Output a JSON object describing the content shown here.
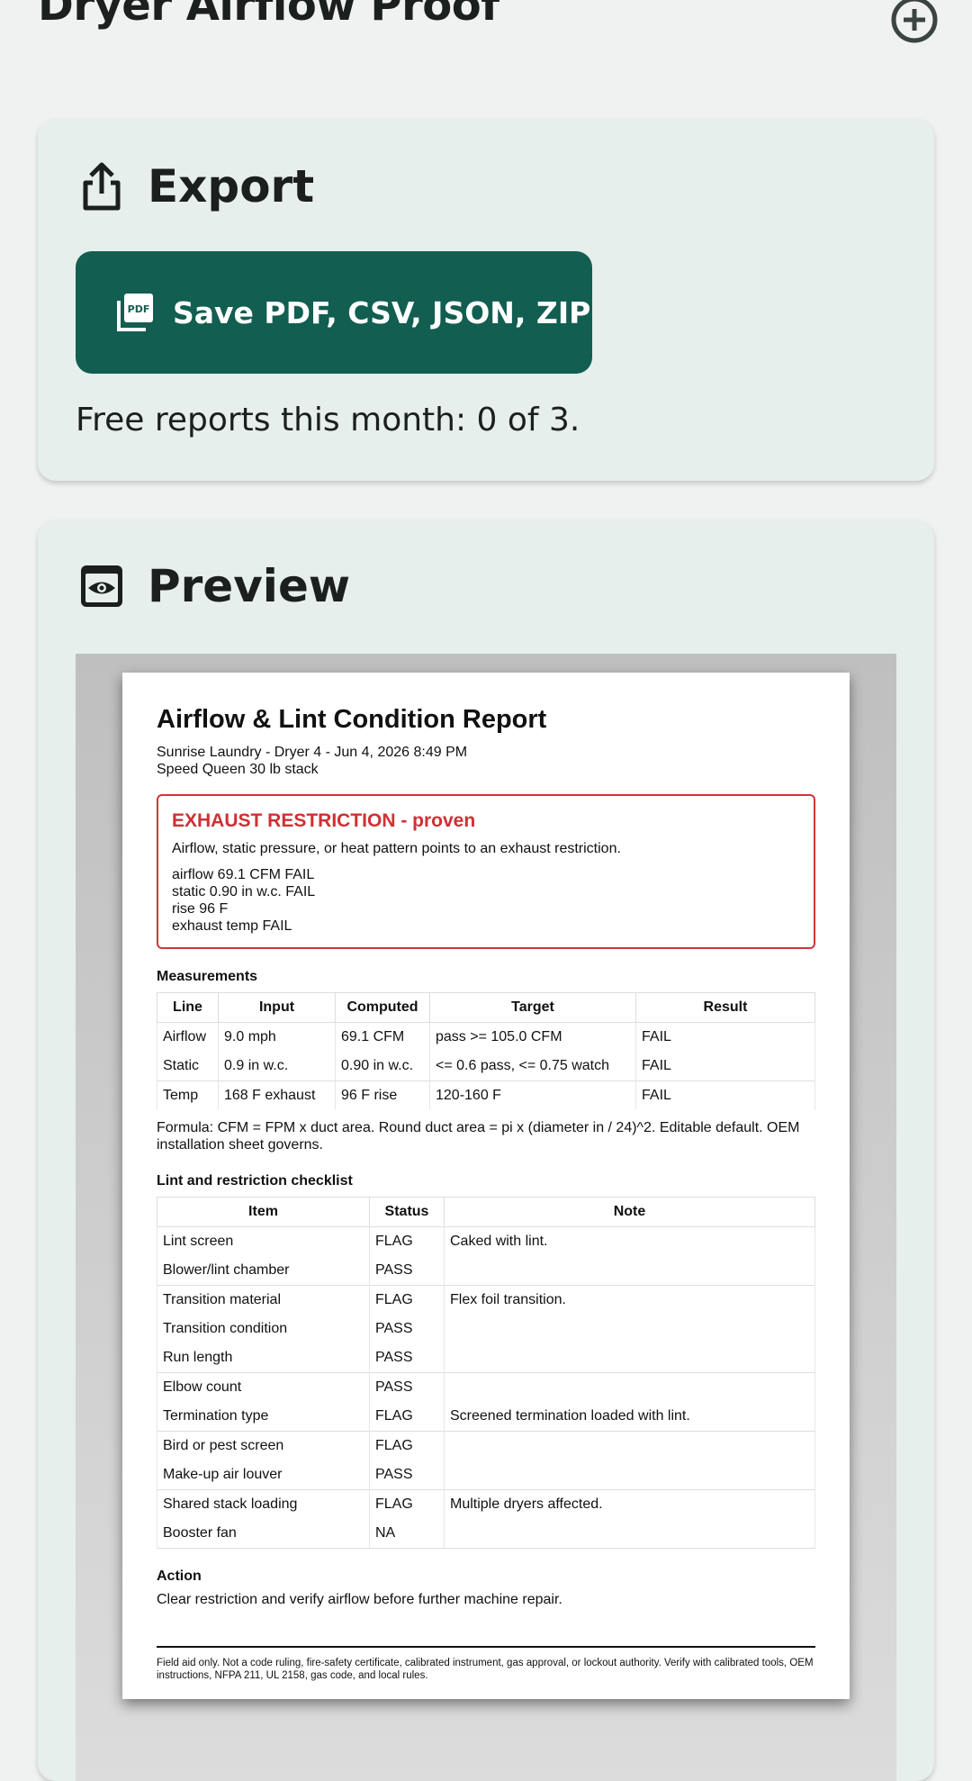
{
  "app": {
    "title": "Dryer Airflow Proof",
    "add_icon": "add-circle-icon"
  },
  "export_card": {
    "icon": "share-upload-icon",
    "title": "Export",
    "save_button_icon": "pdf-file-icon",
    "save_button_label": "Save PDF, CSV, JSON, ZIP",
    "quota_text": "Free reports this month: 0 of 3.",
    "accent_color": "#125e51"
  },
  "preview_card": {
    "icon": "preview-eye-icon",
    "title": "Preview"
  },
  "report": {
    "title": "Airflow & Lint Condition Report",
    "subtitle_line1": "Sunrise Laundry - Dryer 4 - Jun 4, 2026 8:49 PM",
    "subtitle_line2": "Speed Queen 30 lb stack",
    "alert": {
      "color": "#cf3034",
      "title": "EXHAUST RESTRICTION - proven",
      "description": "Airflow, static pressure, or heat pattern points to an exhaust restriction.",
      "lines": [
        "airflow 69.1 CFM FAIL",
        "static 0.90 in w.c. FAIL",
        "rise 96 F",
        "exhaust temp FAIL"
      ]
    },
    "measurements": {
      "title": "Measurements",
      "headers": [
        "Line",
        "Input",
        "Computed",
        "Target",
        "Result"
      ],
      "rows": [
        [
          "Airflow",
          "9.0 mph",
          "69.1 CFM",
          "pass >= 105.0 CFM",
          "FAIL"
        ],
        [
          "Static",
          "0.9 in w.c.",
          "0.90 in w.c.",
          "<= 0.6 pass, <= 0.75 watch",
          "FAIL"
        ],
        [
          "Temp",
          "168 F exhaust",
          "96 F rise",
          "120-160 F",
          "FAIL"
        ]
      ]
    },
    "formula": "Formula: CFM = FPM x duct area. Round duct area = pi x (diameter in / 24)^2. Editable default. OEM installation sheet governs.",
    "checklist": {
      "title": "Lint and restriction checklist",
      "headers": [
        "Item",
        "Status",
        "Note"
      ],
      "rows": [
        [
          "Lint screen",
          "FLAG",
          "Caked with lint."
        ],
        [
          "Blower/lint chamber",
          "PASS",
          ""
        ],
        [
          "Transition material",
          "FLAG",
          "Flex foil transition."
        ],
        [
          "Transition condition",
          "PASS",
          ""
        ],
        [
          "Run length",
          "PASS",
          ""
        ],
        [
          "Elbow count",
          "PASS",
          ""
        ],
        [
          "Termination type",
          "FLAG",
          "Screened termination loaded with lint."
        ],
        [
          "Bird or pest screen",
          "FLAG",
          ""
        ],
        [
          "Make-up air louver",
          "PASS",
          ""
        ],
        [
          "Shared stack loading",
          "FLAG",
          "Multiple dryers affected."
        ],
        [
          "Booster fan",
          "NA",
          ""
        ]
      ]
    },
    "action": {
      "title": "Action",
      "text": "Clear restriction and verify airflow before further machine repair."
    },
    "disclaimer": "Field aid only. Not a code ruling, fire-safety certificate, calibrated instrument, gas approval, or lockout authority. Verify with calibrated tools, OEM instructions, NFPA 211, UL 2158, gas code, and local rules."
  }
}
